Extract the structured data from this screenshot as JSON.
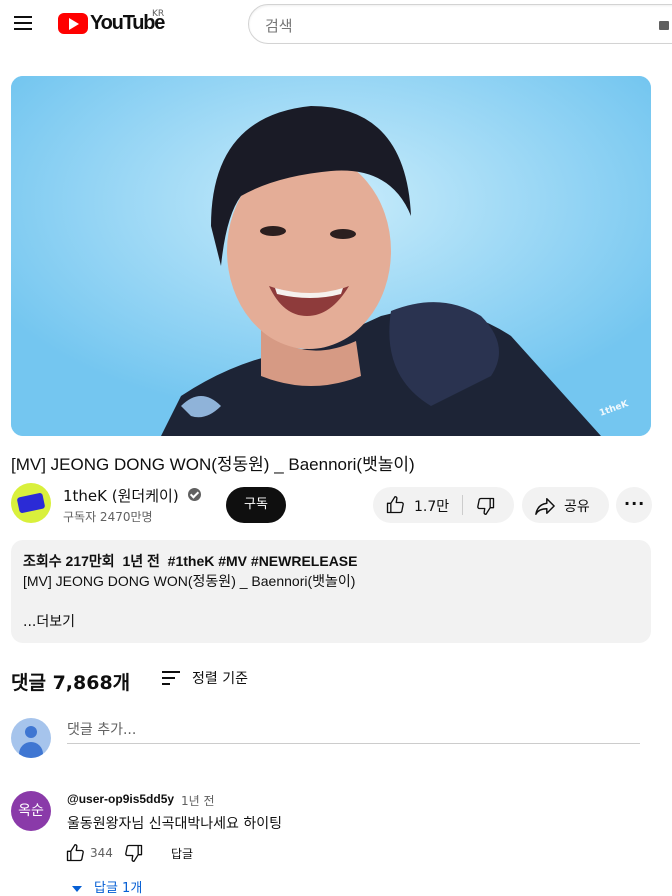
{
  "header": {
    "logo_text": "YouTube",
    "region": "KR",
    "search_placeholder": "검색"
  },
  "video": {
    "title": "[MV] JEONG DONG WON(정동원) _ Baennori(뱃놀이)",
    "watermark": "1theK"
  },
  "channel": {
    "name": "1theK (원더케이)",
    "subscribers": "구독자 2470만명",
    "subscribe_label": "구독"
  },
  "actions": {
    "like_count": "1.7만",
    "share_label": "공유",
    "more_label": "···"
  },
  "description": {
    "views": "조회수 217만회",
    "age": "1년 전",
    "tags": "#1theK #MV #NEWRELEASE",
    "line1": "[MV] JEONG DONG WON(정동원) _ Baennori(뱃놀이)",
    "more_label": "...더보기"
  },
  "comments": {
    "count_label": "댓글 7,868개",
    "sort_label": "정렬 기준",
    "add_placeholder": "댓글 추가...",
    "items": [
      {
        "avatar_text": "옥순",
        "author": "@user-op9is5dd5y",
        "time": "1년 전",
        "text": "울동원왕자님 신곡대박나세요 하이팅",
        "likes": "344",
        "reply_label": "답글",
        "replies_label": "답글 1개"
      }
    ]
  },
  "colors": {
    "brand_red": "#ff0000",
    "accent_blue": "#065fd4",
    "pill_bg": "#f2f2f2"
  }
}
